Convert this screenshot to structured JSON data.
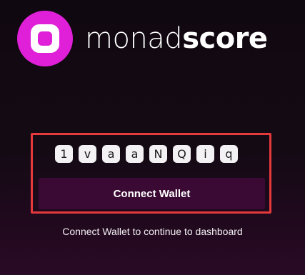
{
  "brand": {
    "name_light": "monad",
    "name_bold": "score",
    "logo_color": "#e020d8"
  },
  "captcha": {
    "chars": [
      "1",
      "v",
      "a",
      "a",
      "N",
      "Q",
      "i",
      "q"
    ]
  },
  "connect": {
    "button_label": "Connect Wallet",
    "hint": "Connect Wallet to continue to dashboard"
  },
  "colors": {
    "highlight_border": "#e5393b",
    "button_bg": "#3a0a34"
  }
}
